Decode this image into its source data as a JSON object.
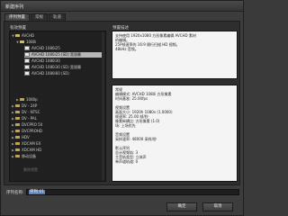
{
  "window": {
    "title": "新建序列"
  },
  "tabs": [
    {
      "label": "序列预置"
    },
    {
      "label": "常规"
    },
    {
      "label": "轨道"
    }
  ],
  "presets": {
    "heading": "有效预置",
    "tree": [
      {
        "label": "AVCHD",
        "icon": "folder-open-icon",
        "expanded": true
      },
      {
        "label": "1080i",
        "icon": "folder-open-icon",
        "expanded": true
      },
      {
        "label": "AVCHD 1080i25",
        "icon": "preset-icon"
      },
      {
        "label": "AVCHD 1080i25 (SD) 宽银幕",
        "icon": "preset-icon",
        "selected": true
      },
      {
        "label": "AVCHD 1080i30",
        "icon": "preset-icon"
      },
      {
        "label": "AVCHD 1080i30 (SD) 宽银幕",
        "icon": "preset-icon"
      },
      {
        "label": "AVCHD 1080i60 (SD)",
        "icon": "preset-icon"
      },
      {
        "label": "1080p",
        "icon": "folder-icon"
      },
      {
        "label": "DV - 24P",
        "icon": "folder-icon"
      },
      {
        "label": "DV - NTSC",
        "icon": "folder-icon"
      },
      {
        "label": "DV - PAL",
        "icon": "folder-icon"
      },
      {
        "label": "DVCPRO 50",
        "icon": "folder-icon"
      },
      {
        "label": "DVCPROHD",
        "icon": "folder-icon"
      },
      {
        "label": "HDV",
        "icon": "folder-icon"
      },
      {
        "label": "XDCAM EX",
        "icon": "folder-icon"
      },
      {
        "label": "XDCAM HD",
        "icon": "folder-icon"
      },
      {
        "label": "移动设备",
        "icon": "folder-icon"
      }
    ],
    "delete_label": "删除预置"
  },
  "description": {
    "heading": "预置描述",
    "text": [
      "支持使用 1920x1080 方形像素编辑 AVCHD 素材",
      "的编辑。",
      "25P帧速率的 16:9 隔行扫描 HD 视频。",
      "48kHz 音频。"
    ]
  },
  "general": {
    "heading": "常规",
    "text": [
      "编辑模式: AVCHD 1080i 方形像素",
      "时间基准: 25.00fps",
      "",
      "视频设置",
      "画面大小: 1920h 1080v (1.0000)",
      "帧速率: 25.00 帧/秒",
      "像素纵横比: 方形像素 (1.0)",
      "场: 上场优先",
      "",
      "音频设置",
      "采样速率: 48000 采样/秒",
      "",
      "默认序列",
      "总计视频轨: 3",
      "主音轨类型: 立体声",
      "单声道轨道: 0"
    ]
  },
  "sequence_name": {
    "label": "序列名称:",
    "value": "序列 01"
  },
  "buttons": {
    "ok": "确定",
    "cancel": "取消"
  }
}
